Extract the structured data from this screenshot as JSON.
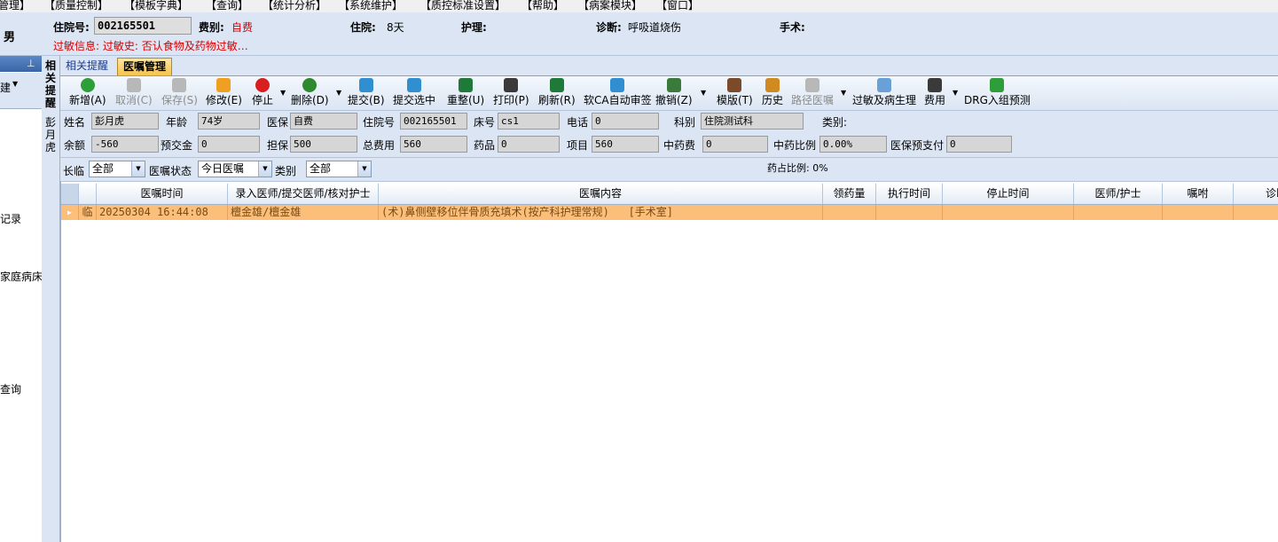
{
  "menu": [
    "管理】",
    "【质量控制】",
    "【模板字典】",
    "【查询】",
    "【统计分析】",
    "【系统维护】",
    "【质控标准设置】",
    "【帮助】",
    "【病案模块】",
    "【窗口】"
  ],
  "patient": {
    "gender": "男",
    "admission_no_label": "住院号:",
    "admission_no": "002165501",
    "fee_label": "费别:",
    "fee": "自费",
    "stay_label": "住院:",
    "stay": "8天",
    "care_label": "护理:",
    "care": "",
    "diagnosis_label": "诊断:",
    "diagnosis": "呼吸道烧伤",
    "surgery_label": "手术:",
    "surgery": "",
    "allergy_info": "过敏信息: 过敏史: 否认食物及药物过敏…"
  },
  "left_panel": {
    "pin_icon": "pin-icon",
    "header_text": "建",
    "items": [
      "记录",
      "家庭病床",
      "查询"
    ]
  },
  "vertical_tab": {
    "text": "相关提醒",
    "patient_name_vertical": "彭月虎"
  },
  "tabs": [
    "相关提醒",
    "医嘱管理"
  ],
  "toolbar": [
    {
      "label": "新增(A)",
      "icon": "add-icon",
      "color": "#2e9e3a",
      "enabled": true
    },
    {
      "label": "取消(C)",
      "icon": "undo-icon",
      "color": "#a0a0a0",
      "enabled": false
    },
    {
      "label": "保存(S)",
      "icon": "save-icon",
      "color": "#a0a0a0",
      "enabled": false
    },
    {
      "label": "修改(E)",
      "icon": "edit-icon",
      "color": "#f0a020",
      "enabled": true
    },
    {
      "label": "停止",
      "icon": "stop-icon",
      "color": "#d81e1e",
      "enabled": true
    },
    {
      "label": "删除(D)",
      "icon": "delete-icon",
      "color": "#2e8a2e",
      "enabled": true
    },
    {
      "label": "提交(B)",
      "icon": "submit-icon",
      "color": "#2f8fd0",
      "enabled": true
    },
    {
      "label": "提交选中",
      "icon": "submit-selected-icon",
      "color": "#2f8fd0",
      "enabled": true
    },
    {
      "label": "重整(U)",
      "icon": "reorganize-icon",
      "color": "#1f7a3a",
      "enabled": true
    },
    {
      "label": "打印(P)",
      "icon": "print-icon",
      "color": "#3a3a3a",
      "enabled": true
    },
    {
      "label": "刷新(R)",
      "icon": "refresh-icon",
      "color": "#1f7a3a",
      "enabled": true
    },
    {
      "label": "软CA自动审签",
      "icon": "ca-sign-icon",
      "color": "#2f8fd0",
      "enabled": true
    },
    {
      "label": "撤销(Z)",
      "icon": "revoke-icon",
      "color": "#3a7a3a",
      "enabled": true
    },
    {
      "label": "模版(T)",
      "icon": "template-icon",
      "color": "#7a4a2a",
      "enabled": true
    },
    {
      "label": "历史",
      "icon": "history-icon",
      "color": "#d08a20",
      "enabled": true
    },
    {
      "label": "路径医嘱",
      "icon": "pathway-icon",
      "color": "#a0a0a0",
      "enabled": false
    },
    {
      "label": "过敏及病生理",
      "icon": "allergy-icon",
      "color": "#6aa0d8",
      "enabled": true
    },
    {
      "label": "费用",
      "icon": "fee-icon",
      "color": "#3a3a3a",
      "enabled": true
    },
    {
      "label": "DRG入组预测",
      "icon": "drg-icon",
      "color": "#2e9e3a",
      "enabled": true
    }
  ],
  "info": {
    "name_label": "姓名",
    "name": "彭月虎",
    "age_label": "年龄",
    "age": "74岁",
    "insurance_label": "医保",
    "insurance": "自费",
    "admission_label": "住院号",
    "admission": "002165501",
    "bed_label": "床号",
    "bed": "cs1",
    "phone_label": "电话",
    "phone": "0",
    "dept_label": "科别",
    "dept": "住院测试科",
    "category_label": "类别:",
    "balance_label": "余额",
    "balance": "-560",
    "prepay_label": "预交金",
    "prepay": "0",
    "guarantee_label": "担保",
    "guarantee": "500",
    "total_label": "总费用",
    "total": "560",
    "drug_label": "药品",
    "drug": "0",
    "item_label": "项目",
    "item": "560",
    "herbal_label": "中药费",
    "herbal": "0",
    "herbal_ratio_label": "中药比例",
    "herbal_ratio": "0.00%",
    "insurance_prepay_label": "医保预支付",
    "insurance_prepay": "0"
  },
  "filter": {
    "long_temp_label": "长临",
    "long_temp": "全部",
    "status_label": "医嘱状态",
    "status": "今日医嘱",
    "category_label": "类别",
    "category": "全部",
    "drug_ratio": "药占比例: 0%"
  },
  "grid": {
    "headers": [
      "医嘱时间",
      "录入医师/提交医师/核对护士",
      "医嘱内容",
      "领药量",
      "执行时间",
      "停止时间",
      "医师/护士",
      "嘱咐",
      "诊断"
    ],
    "rows": [
      {
        "type": "临",
        "time": "20250304 16:44:08",
        "doctors": "檀金雄/檀金雄",
        "content": "(术)鼻侧壁移位伴骨质充填术(按产科护理常规)   [手术室]",
        "qty": "",
        "exec": "",
        "stop": "",
        "doctor_nurse": "",
        "note": "",
        "diag": ""
      }
    ]
  }
}
